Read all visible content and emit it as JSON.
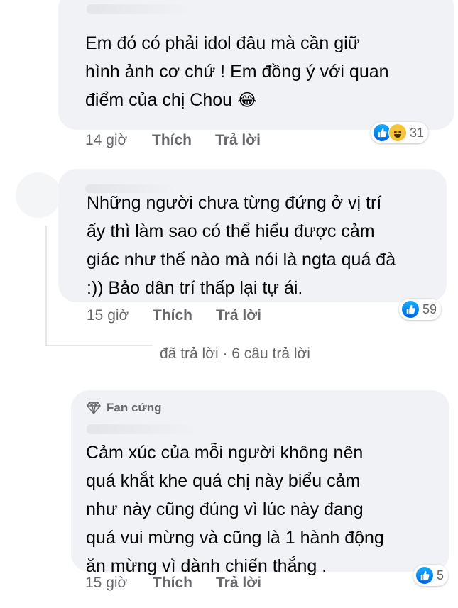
{
  "comments": [
    {
      "text_lines": [
        "Em đó có phải idol đâu mà cần giữ",
        "hình ảnh cơ chứ ! Em đồng ý với quan",
        "điểm của chị Chou"
      ],
      "time": "14 giờ",
      "like_label": "Thích",
      "reply_label": "Trả lời",
      "reaction_count": "31",
      "reactions": [
        "like-icon",
        "haha-icon"
      ]
    },
    {
      "text_lines": [
        "Những người chưa  từng đứng ở vị trí",
        "ấy thì làm sao có thể hiểu được cảm",
        "giác như thế nào mà nói là ngta quá đà",
        ":)) Bảo dân trí thấp lại tự ái."
      ],
      "time": "15 giờ",
      "like_label": "Thích",
      "reply_label": "Trả lời",
      "reaction_count": "59",
      "reactions": [
        "like-icon"
      ]
    },
    {
      "badge": "Fan cứng",
      "text_lines": [
        "Cảm xúc của mỗi người không nên",
        "quá khắt khe quá chị này biểu cảm",
        "như này cũng đúng vì lúc này đang",
        "quá vui mừng và cũng là 1 hành động",
        "ăn mừng vì dành chiến thắng ."
      ],
      "time": "15 giờ",
      "like_label": "Thích",
      "reply_label": "Trả lời",
      "reaction_count": "5",
      "reactions": [
        "like-icon"
      ]
    }
  ],
  "replies_link": "đã trả lời · 6 câu trả lời",
  "emoji": "😂",
  "colors": {
    "bubble": "#f0f2f5",
    "meta": "#65676b",
    "like_blue": "#1877f2"
  }
}
